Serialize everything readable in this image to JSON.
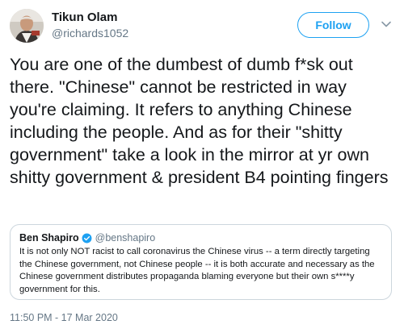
{
  "tweet": {
    "author": {
      "display_name": "Tikun Olam",
      "handle": "@richards1052",
      "avatar_icon": "profile-photo"
    },
    "follow_label": "Follow",
    "menu_icon": "chevron-down-icon",
    "text": "You are one of the dumbest of dumb f*sk out there. \"Chinese\" cannot be restricted in way you're claiming. It refers to anything Chinese including the people. And as for their \"shitty government\" take a look in the mirror at yr own shitty government & president B4 pointing fingers",
    "timestamp": "11:50 PM - 17 Mar 2020"
  },
  "quoted_tweet": {
    "author": {
      "display_name": "Ben Shapiro",
      "handle": "@benshapiro",
      "verified": true
    },
    "text": "It is not only NOT racist to call coronavirus the Chinese virus -- a term directly targeting the Chinese government, not Chinese people -- it is both accurate and necessary as the Chinese government distributes propaganda blaming everyone but their own s****y government for this."
  },
  "colors": {
    "accent": "#1da1f2",
    "secondary_text": "#657786",
    "border": "#ccd6dd"
  }
}
